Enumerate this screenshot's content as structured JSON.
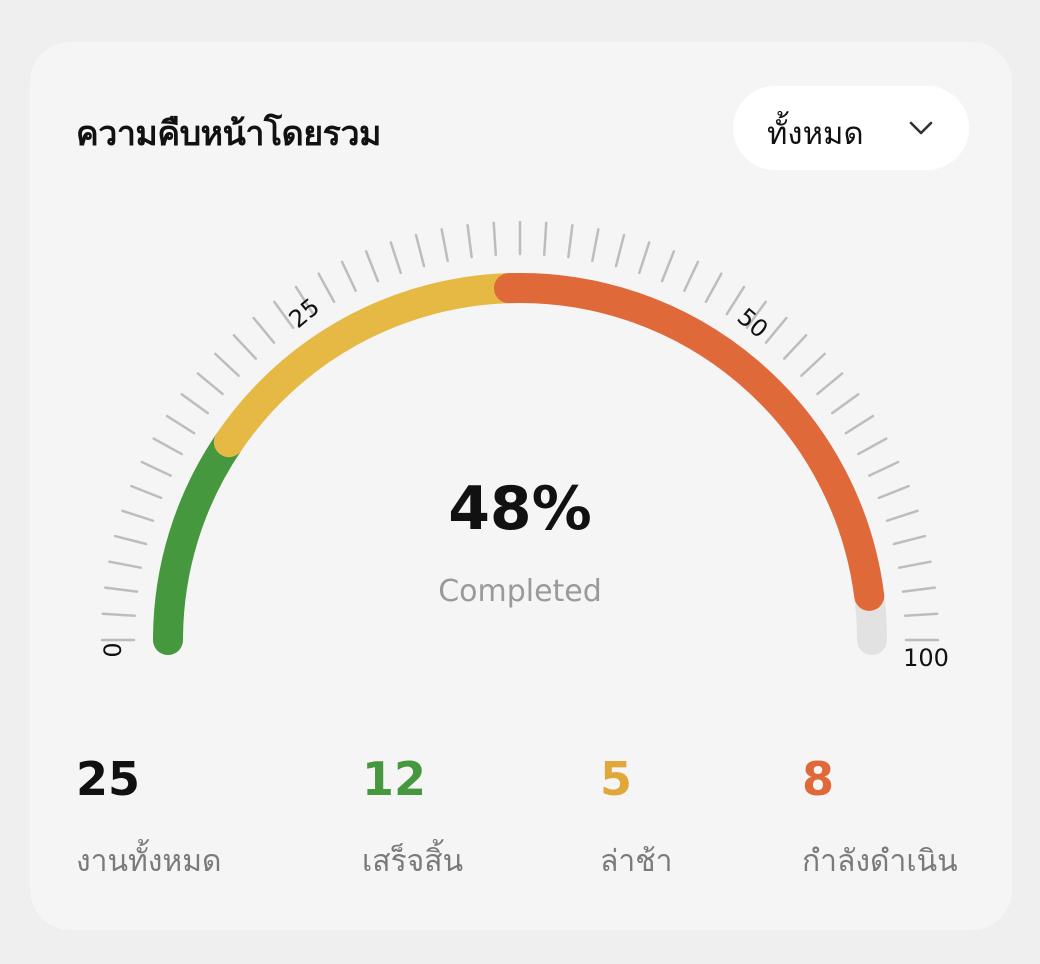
{
  "header": {
    "title": "ความคืบหน้าโดยรวม",
    "filter": {
      "selected": "ทั้งหมด",
      "icon": "chevron-down-icon"
    }
  },
  "gauge": {
    "percent_text": "48%",
    "caption": "Completed",
    "scale_labels": [
      "0",
      "25",
      "50",
      "100"
    ],
    "segments": [
      {
        "name": "green",
        "from": 0,
        "to": 19,
        "color": "#46983e"
      },
      {
        "name": "yellow",
        "from": 19,
        "to": 49,
        "color": "#e6b944"
      },
      {
        "name": "orange",
        "from": 49,
        "to": 96,
        "color": "#e0693a"
      }
    ],
    "track_color": "#e2e2e2",
    "tick_color": "#bdbdbd"
  },
  "stats": [
    {
      "value": "25",
      "label": "งานทั้งหมด",
      "color": "#111111"
    },
    {
      "value": "12",
      "label": "เสร็จสิ้น",
      "color": "#46983e"
    },
    {
      "value": "5",
      "label": "ล่าช้า",
      "color": "#e0a83a"
    },
    {
      "value": "8",
      "label": "กำลังดำเนิน",
      "color": "#e0693a"
    }
  ]
}
